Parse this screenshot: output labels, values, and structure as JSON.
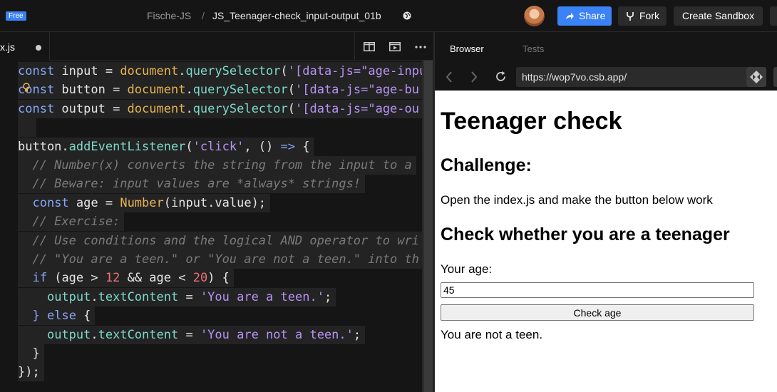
{
  "topbar": {
    "plan_badge": "Free",
    "team": "Fische-JS",
    "separator": "/",
    "sandbox_name": "JS_Teenager-check_input-output_01b",
    "share_label": "Share",
    "fork_label": "Fork",
    "create_label": "Create Sandbox",
    "accent_color": "#3b82f6"
  },
  "editor": {
    "file_name": "x.js",
    "lines": [
      [
        [
          "k",
          "const"
        ],
        [
          "v",
          " input = "
        ],
        [
          "cls",
          "document"
        ],
        [
          "v",
          "."
        ],
        [
          "f",
          "querySelector"
        ],
        [
          "v",
          "("
        ],
        [
          "s",
          "'[data-js=\"age-inpu"
        ]
      ],
      [
        [
          "k",
          "const"
        ],
        [
          "v",
          " button = "
        ],
        [
          "cls",
          "document"
        ],
        [
          "v",
          "."
        ],
        [
          "f",
          "querySelector"
        ],
        [
          "v",
          "("
        ],
        [
          "s",
          "'[data-js=\"age-bu"
        ]
      ],
      [
        [
          "k",
          "const"
        ],
        [
          "v",
          " output = "
        ],
        [
          "cls",
          "document"
        ],
        [
          "v",
          "."
        ],
        [
          "f",
          "querySelector"
        ],
        [
          "v",
          "("
        ],
        [
          "s",
          "'[data-js=\"age-ou"
        ]
      ],
      [
        [
          "v",
          "  "
        ]
      ],
      [
        [
          "v",
          "button."
        ],
        [
          "f",
          "addEventListener"
        ],
        [
          "v",
          "("
        ],
        [
          "s",
          "'click'"
        ],
        [
          "v",
          ", () "
        ],
        [
          "k",
          "=>"
        ],
        [
          "v",
          " {"
        ]
      ],
      [
        [
          "c",
          "  // Number(x) converts the string from the input to a"
        ]
      ],
      [
        [
          "c",
          "  // Beware: input values are *always* strings!"
        ]
      ],
      [
        [
          "v",
          "  "
        ],
        [
          "k",
          "const"
        ],
        [
          "v",
          " age = "
        ],
        [
          "cls",
          "Number"
        ],
        [
          "v",
          "(input.value);"
        ]
      ],
      [
        [
          "c",
          "  // Exercise:"
        ]
      ],
      [
        [
          "c",
          "  // Use conditions and the logical AND operator to wri"
        ]
      ],
      [
        [
          "c",
          "  // \"You are a teen.\" or \"You are not a teen.\" into th"
        ]
      ],
      [
        [
          "v",
          "  "
        ],
        [
          "k",
          "if"
        ],
        [
          "v",
          " (age > "
        ],
        [
          "n",
          "12"
        ],
        [
          "v",
          " && age < "
        ],
        [
          "n",
          "20"
        ],
        [
          "v",
          ") {"
        ]
      ],
      [
        [
          "v",
          "    "
        ],
        [
          "f",
          "output"
        ],
        [
          "v",
          "."
        ],
        [
          "f",
          "textContent"
        ],
        [
          "v",
          " = "
        ],
        [
          "s",
          "'You are a teen.'"
        ],
        [
          "v",
          ";"
        ]
      ],
      [
        [
          "v",
          "  "
        ],
        [
          "k",
          "}"
        ],
        [
          "v",
          " "
        ],
        [
          "k",
          "else"
        ],
        [
          "v",
          " {"
        ]
      ],
      [
        [
          "v",
          "    "
        ],
        [
          "f",
          "output"
        ],
        [
          "v",
          "."
        ],
        [
          "f",
          "textContent"
        ],
        [
          "v",
          " = "
        ],
        [
          "s",
          "'You are not a teen.'"
        ],
        [
          "v",
          ";"
        ]
      ],
      [
        [
          "v",
          "  }"
        ]
      ],
      [
        [
          "v",
          "});"
        ]
      ]
    ]
  },
  "preview": {
    "tab_browser": "Browser",
    "tab_tests": "Tests",
    "url": "https://wop7vo.csb.app/",
    "page": {
      "title": "Teenager check",
      "challenge_heading": "Challenge:",
      "challenge_text": "Open the index.js and make the button below work",
      "check_heading": "Check whether you are a teenager",
      "age_label": "Your age:",
      "age_value": "45",
      "button_label": "Check age",
      "result": "You are not a teen."
    }
  }
}
